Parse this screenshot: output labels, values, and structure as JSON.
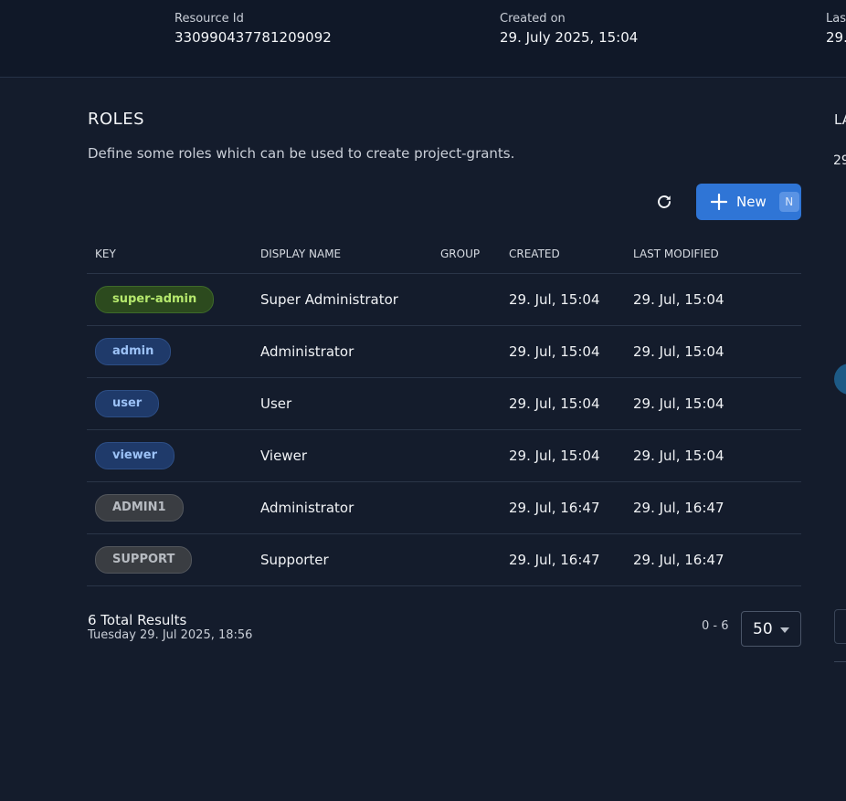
{
  "header": {
    "resource_id": {
      "label": "Resource Id",
      "value": "330990437781209092"
    },
    "created_on": {
      "label": "Created on",
      "value": "29. July 2025, 15:04"
    },
    "last_modified": {
      "label": "Last",
      "value": "29."
    }
  },
  "roles": {
    "title": "ROLES",
    "description": "Define some roles which can be used to create project-grants.",
    "new_button_label": "New",
    "new_button_shortcut": "N",
    "columns": [
      "KEY",
      "DISPLAY NAME",
      "GROUP",
      "CREATED",
      "LAST MODIFIED"
    ],
    "rows": [
      {
        "key": "super-admin",
        "display_name": "Super Administrator",
        "group": "",
        "created": "29. Jul, 15:04",
        "last_modified": "29. Jul, 15:04",
        "chip_color": "#b5e86d"
      },
      {
        "key": "admin",
        "display_name": "Administrator",
        "group": "",
        "created": "29. Jul, 15:04",
        "last_modified": "29. Jul, 15:04",
        "chip_color": "#9cc2f7"
      },
      {
        "key": "user",
        "display_name": "User",
        "group": "",
        "created": "29. Jul, 15:04",
        "last_modified": "29. Jul, 15:04",
        "chip_color": "#9cc2f7"
      },
      {
        "key": "viewer",
        "display_name": "Viewer",
        "group": "",
        "created": "29. Jul, 15:04",
        "last_modified": "29. Jul, 15:04",
        "chip_color": "#9cc2f7"
      },
      {
        "key": "ADMIN1",
        "display_name": "Administrator",
        "group": "",
        "created": "29. Jul, 16:47",
        "last_modified": "29. Jul, 16:47",
        "chip_color": "#b7bbc1"
      },
      {
        "key": "SUPPORT",
        "display_name": "Supporter",
        "group": "",
        "created": "29. Jul, 16:47",
        "last_modified": "29. Jul, 16:47",
        "chip_color": "#b7bbc1"
      }
    ],
    "footer": {
      "total": "6 Total Results",
      "timestamp": "Tuesday 29. Jul 2025, 18:56",
      "range": "0 - 6",
      "page_size": "50"
    }
  },
  "side_panel": {
    "label": "LA",
    "value": "29"
  },
  "colors": {
    "accent": "#2f75d6",
    "background": "#141c2c",
    "header_background": "#101828"
  },
  "icons": {
    "refresh": "refresh-icon",
    "plus": "plus-icon",
    "dropdown": "chevron-down-icon"
  }
}
